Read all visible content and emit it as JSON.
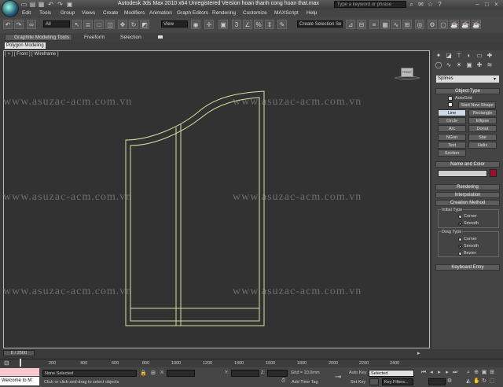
{
  "titlebar": {
    "title": "Autodesk 3ds Max 2010 x64    Unregistered Version    hoan thanh cong hoan that.max",
    "search_placeholder": "Type a keyword or phrase"
  },
  "menu": [
    "Edit",
    "Tools",
    "Group",
    "Views",
    "Create",
    "Modifiers",
    "Animation",
    "Graph Editors",
    "Rendering",
    "Customize",
    "MAXScript",
    "Help"
  ],
  "toolbar": {
    "filter_value": "All",
    "refcoord_value": "View",
    "selection_set_value": "Create Selection Se"
  },
  "ribbon": {
    "tabs": [
      "Graphite Modeling Tools",
      "Freeform",
      "Selection"
    ],
    "panel_label": "Polygon Modeling"
  },
  "viewport": {
    "label": "[ + ] [ Front ] [ Wireframe ]",
    "watermark": "www.asuzac-acm.com.vn",
    "cube_label": "FRONT",
    "line_color": "#d9e0a0"
  },
  "command_panel": {
    "category": "Splines",
    "object_type": {
      "title": "Object Type",
      "autogrid": "AutoGrid",
      "start_new_shape": "Start New Shape",
      "buttons": [
        "Line",
        "Rectangle",
        "Circle",
        "Ellipse",
        "Arc",
        "Donut",
        "NGon",
        "Star",
        "Text",
        "Helix",
        "Section"
      ]
    },
    "name_color": {
      "title": "Name and Color",
      "color": "#a0102a"
    },
    "rendering": "Rendering",
    "interpolation": "Interpolation",
    "creation_method": {
      "title": "Creation Method",
      "initial_type": "Initial Type",
      "initial_options": [
        "Corner",
        "Smooth"
      ],
      "drag_type": "Drag Type",
      "drag_options": [
        "Corner",
        "Smooth",
        "Bezier"
      ]
    },
    "keyboard_entry": "Keyboard Entry"
  },
  "timeline": {
    "frame_display": "0 / 2500",
    "ticks": [
      "200",
      "400",
      "600",
      "800",
      "1000",
      "1200",
      "1400",
      "1600",
      "1800",
      "2000",
      "2200",
      "2400"
    ]
  },
  "statusbar": {
    "maxscript_label": "",
    "welcome": "Welcome to M:",
    "selection_status": "None Selected",
    "prompt": "Click or click-and-drag to select objects",
    "prompt2": "Click or click-and-drag to select objects",
    "x_label": "X:",
    "y_label": "Y:",
    "z_label": "Z:",
    "grid": "Grid = 10.0mm",
    "auto_key": "Auto Key",
    "set_key": "Set Key",
    "selected_value": "Selected",
    "key_filters": "Key Filters...",
    "add_time_tag": "Add Time Tag",
    "lock_prefix": "",
    "lock_text": ""
  }
}
